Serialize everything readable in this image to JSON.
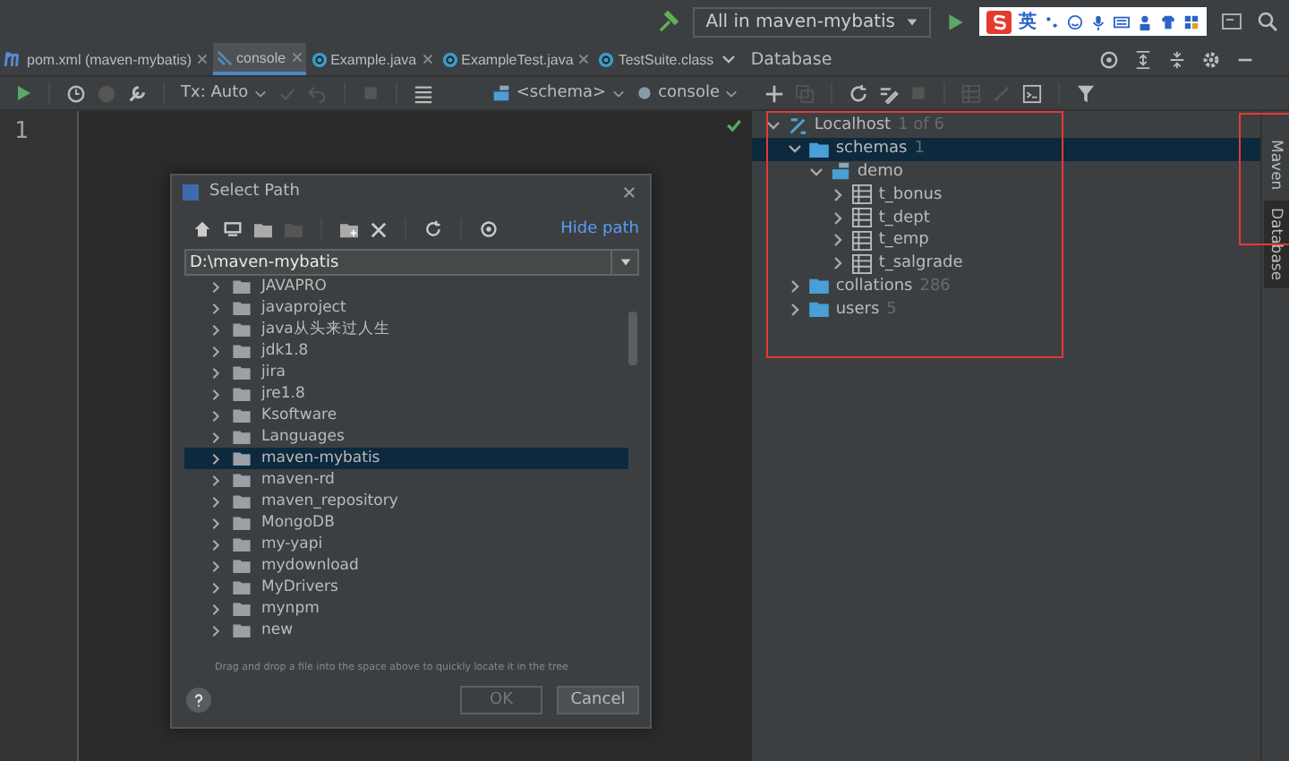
{
  "ime_bar": {
    "mode": "英"
  },
  "run_config": {
    "label": "All in maven-mybatis"
  },
  "editor_tabs": [
    {
      "label": "pom.xml (maven-mybatis)",
      "kind": "maven",
      "selected": false,
      "closable": true
    },
    {
      "label": "console",
      "kind": "console",
      "selected": true,
      "closable": true
    },
    {
      "label": "Example.java",
      "kind": "class",
      "selected": false,
      "closable": true
    },
    {
      "label": "ExampleTest.java",
      "kind": "class",
      "selected": false,
      "closable": true
    },
    {
      "label": "TestSuite.class",
      "kind": "class",
      "selected": false,
      "closable": false
    }
  ],
  "editor_toolbar": {
    "tx_mode": "Tx: Auto",
    "schema": "<schema>",
    "session": "console"
  },
  "editor": {
    "line_numbers": [
      "1"
    ]
  },
  "database_panel": {
    "title": "Database",
    "tree": [
      {
        "label": "Localhost",
        "count": "1 of 6",
        "kind": "host",
        "expanded": true,
        "selected": false,
        "children": [
          {
            "label": "schemas",
            "count": "1",
            "kind": "folder",
            "expanded": true,
            "selected": true,
            "children": [
              {
                "label": "demo",
                "kind": "schema",
                "expanded": true,
                "selected": false,
                "children": [
                  {
                    "label": "t_bonus",
                    "kind": "table",
                    "expanded": false,
                    "selected": false
                  },
                  {
                    "label": "t_dept",
                    "kind": "table",
                    "expanded": false,
                    "selected": false
                  },
                  {
                    "label": "t_emp",
                    "kind": "table",
                    "expanded": false,
                    "selected": false
                  },
                  {
                    "label": "t_salgrade",
                    "kind": "table",
                    "expanded": false,
                    "selected": false
                  }
                ]
              }
            ]
          },
          {
            "label": "collations",
            "count": "286",
            "kind": "folder",
            "expanded": false,
            "selected": false
          },
          {
            "label": "users",
            "count": "5",
            "kind": "folder",
            "expanded": false,
            "selected": false
          }
        ]
      }
    ]
  },
  "side_strip": [
    {
      "label": "Maven",
      "selected": false
    },
    {
      "label": "Database",
      "selected": true
    }
  ],
  "dialog": {
    "title": "Select Path",
    "hide_path_link": "Hide path",
    "path": "D:\\maven-mybatis",
    "folders": [
      {
        "label": "JAVAPRO",
        "selected": false
      },
      {
        "label": "javaproject",
        "selected": false
      },
      {
        "label": "java从头来过人生",
        "selected": false
      },
      {
        "label": "jdk1.8",
        "selected": false
      },
      {
        "label": "jira",
        "selected": false
      },
      {
        "label": "jre1.8",
        "selected": false
      },
      {
        "label": "Ksoftware",
        "selected": false
      },
      {
        "label": "Languages",
        "selected": false
      },
      {
        "label": "maven-mybatis",
        "selected": true
      },
      {
        "label": "maven-rd",
        "selected": false
      },
      {
        "label": "maven_repository",
        "selected": false
      },
      {
        "label": "MongoDB",
        "selected": false
      },
      {
        "label": "my-yapi",
        "selected": false
      },
      {
        "label": "mydownload",
        "selected": false
      },
      {
        "label": "MyDrivers",
        "selected": false
      },
      {
        "label": "mynpm",
        "selected": false
      },
      {
        "label": "new",
        "selected": false
      }
    ],
    "hint": "Drag and drop a file into the space above to quickly locate it in the tree",
    "buttons": [
      {
        "label": "OK",
        "kind": "default"
      },
      {
        "label": "Cancel",
        "kind": "normal"
      }
    ]
  }
}
